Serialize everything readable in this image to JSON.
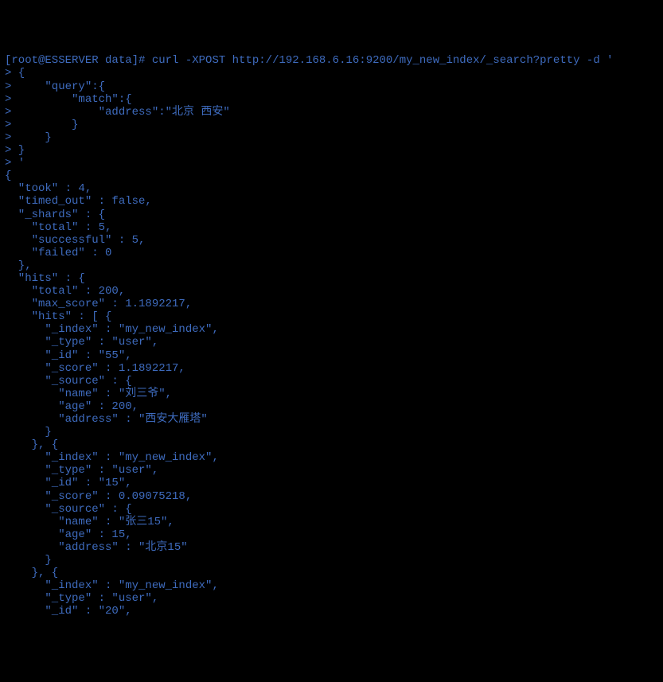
{
  "terminal": {
    "prompt": "[root@ESSERVER data]# ",
    "command": "curl -XPOST http://192.168.6.16:9200/my_new_index/_search?pretty -d '",
    "input_lines": [
      "> {",
      ">     \"query\":{",
      ">         \"match\":{",
      ">             \"address\":\"北京 西安\"",
      ">         }",
      ">     }",
      "> }",
      "> '"
    ],
    "response_lines": [
      "{",
      "  \"took\" : 4,",
      "  \"timed_out\" : false,",
      "  \"_shards\" : {",
      "    \"total\" : 5,",
      "    \"successful\" : 5,",
      "    \"failed\" : 0",
      "  },",
      "  \"hits\" : {",
      "    \"total\" : 200,",
      "    \"max_score\" : 1.1892217,",
      "    \"hits\" : [ {",
      "      \"_index\" : \"my_new_index\",",
      "      \"_type\" : \"user\",",
      "      \"_id\" : \"55\",",
      "      \"_score\" : 1.1892217,",
      "      \"_source\" : {",
      "        \"name\" : \"刘三爷\",",
      "        \"age\" : 200,",
      "        \"address\" : \"西安大雁塔\"",
      "      }",
      "    }, {",
      "      \"_index\" : \"my_new_index\",",
      "      \"_type\" : \"user\",",
      "      \"_id\" : \"15\",",
      "      \"_score\" : 0.09075218,",
      "      \"_source\" : {",
      "        \"name\" : \"张三15\",",
      "        \"age\" : 15,",
      "        \"address\" : \"北京15\"",
      "      }",
      "    }, {",
      "      \"_index\" : \"my_new_index\",",
      "      \"_type\" : \"user\",",
      "      \"_id\" : \"20\","
    ]
  }
}
